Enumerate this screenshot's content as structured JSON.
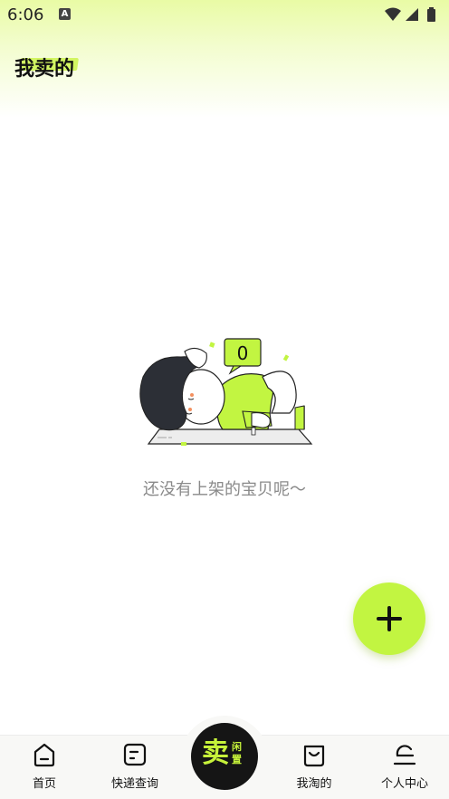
{
  "status_bar": {
    "time": "6:06",
    "notification_icon": "a-app-icon",
    "right_icons": [
      "wifi-icon",
      "signal-icon",
      "battery-icon"
    ]
  },
  "header": {
    "title": "我卖的"
  },
  "empty_state": {
    "illustration": "person-sleeping-on-laptop-illustration",
    "bubble_count": "0",
    "message": "还没有上架的宝贝呢～"
  },
  "fab": {
    "icon": "plus-icon"
  },
  "tabbar": {
    "items": [
      {
        "label": "首页",
        "icon": "home-icon"
      },
      {
        "label": "快递查询",
        "icon": "package-query-icon"
      },
      {
        "label": "我淘的",
        "icon": "shopping-bag-icon"
      },
      {
        "label": "个人中心",
        "icon": "profile-icon"
      }
    ],
    "sell": {
      "main": "卖",
      "sub": "闲置"
    }
  },
  "colors": {
    "accent": "#c2f541",
    "dark": "#151515",
    "muted_text": "#8a8a8a"
  }
}
